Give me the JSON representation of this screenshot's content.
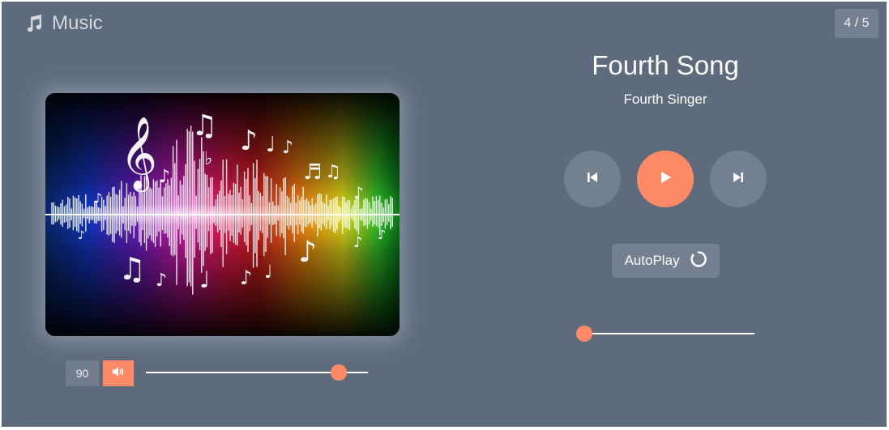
{
  "header": {
    "app_title": "Music",
    "logo_icon": "music-note-icon",
    "track_counter": "4 / 5"
  },
  "now_playing": {
    "title": "Fourth Song",
    "artist": "Fourth Singer",
    "cover_art": "colorful-music-notes-sound-wave"
  },
  "controls": {
    "prev_icon": "skip-previous-icon",
    "play_icon": "play-icon",
    "next_icon": "skip-next-icon",
    "autoplay_label": "AutoPlay",
    "autoplay_icon": "loop-icon"
  },
  "volume": {
    "value": "90",
    "level": 0.87,
    "icon": "speaker-icon"
  },
  "seek": {
    "progress": 0.0
  },
  "colors": {
    "background": "#5e6b7c",
    "accent": "#ff8a65",
    "button": "#74808f",
    "text": "#ffffff"
  }
}
